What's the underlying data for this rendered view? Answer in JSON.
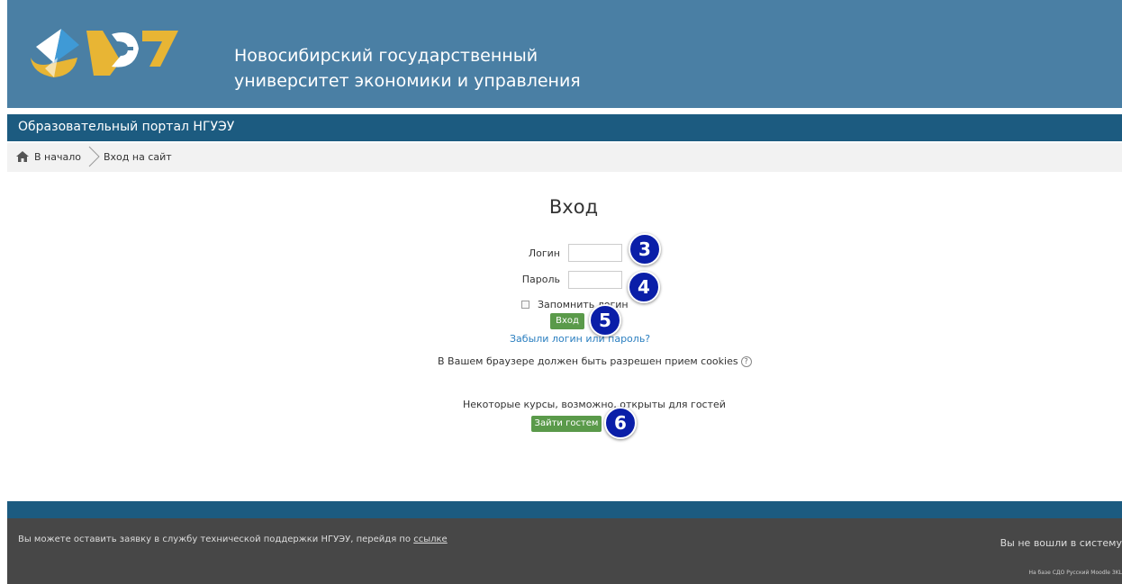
{
  "header": {
    "univ_line1": "Новосибирский государственный",
    "univ_line2": "университет экономики и управления"
  },
  "nav": {
    "portal_title": "Образовательный портал НГУЭУ"
  },
  "breadcrumb": {
    "home": "В начало",
    "current": "Вход на сайт"
  },
  "login": {
    "title": "Вход",
    "username_label": "Логин",
    "username_value": "",
    "password_label": "Пароль",
    "password_value": "",
    "remember_label": "Запомнить логин",
    "submit_label": "Вход",
    "forgot_link": "Забыли логин или пароль?",
    "cookies_notice": "В Вашем браузере должен быть разрешен прием cookies",
    "guest_notice": "Некоторые курсы, возможно, открыты для гостей",
    "guest_button": "Зайти гостем"
  },
  "markers": [
    "3",
    "4",
    "5",
    "6"
  ],
  "footer": {
    "support_text": "Вы можете оставить заявку в службу технической поддержки НГУЭУ, перейдя по ",
    "support_link": "ссылке",
    "not_logged": "Вы не вошли в систему",
    "powered": "На базе СДО Русский Moodle 3KL"
  },
  "colors": {
    "header_bg": "#4a7fa4",
    "nav_bg": "#1c5b80",
    "footer_bg": "#474747",
    "button_green": "#5a9a4a",
    "marker_blue": "#0a1ea8",
    "link_blue": "#2b7fc0"
  }
}
